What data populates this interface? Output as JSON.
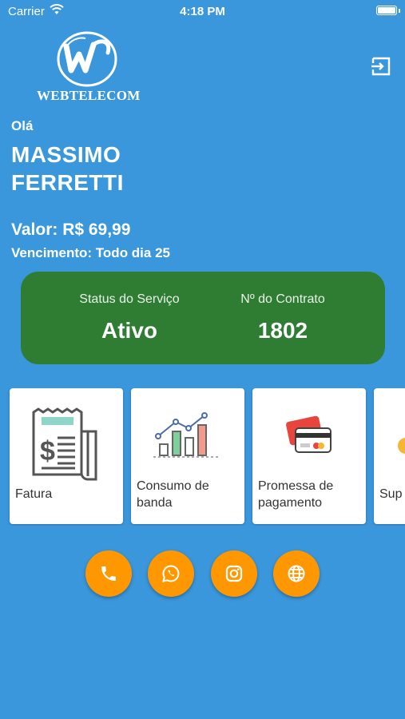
{
  "status_bar": {
    "carrier": "Carrier",
    "time": "4:18 PM"
  },
  "logo": {
    "text": "WEBTELECOM"
  },
  "greeting": "Olá",
  "customer": {
    "first_name": "MASSIMO",
    "last_name": "FERRETTI"
  },
  "billing": {
    "valor": "Valor: R$ 69,99",
    "vencimento": "Vencimento: Todo dia 25"
  },
  "service": {
    "status_label": "Status do Serviço",
    "status_value": "Ativo",
    "contract_label": "Nº do Contrato",
    "contract_value": "1802",
    "card_color": "#2e7d32"
  },
  "menu": [
    {
      "line1": "Fatura",
      "line2": "",
      "icon": "invoice-icon"
    },
    {
      "line1": "Consumo de",
      "line2": "banda",
      "icon": "bandwidth-chart-icon"
    },
    {
      "line1": "Promessa de",
      "line2": "pagamento",
      "icon": "credit-card-icon"
    },
    {
      "line1": "Sup",
      "line2": "",
      "icon": "support-icon"
    }
  ],
  "social": [
    "phone-icon",
    "whatsapp-icon",
    "instagram-icon",
    "globe-icon"
  ],
  "colors": {
    "background": "#3a97dc",
    "accent": "#ff9800"
  }
}
